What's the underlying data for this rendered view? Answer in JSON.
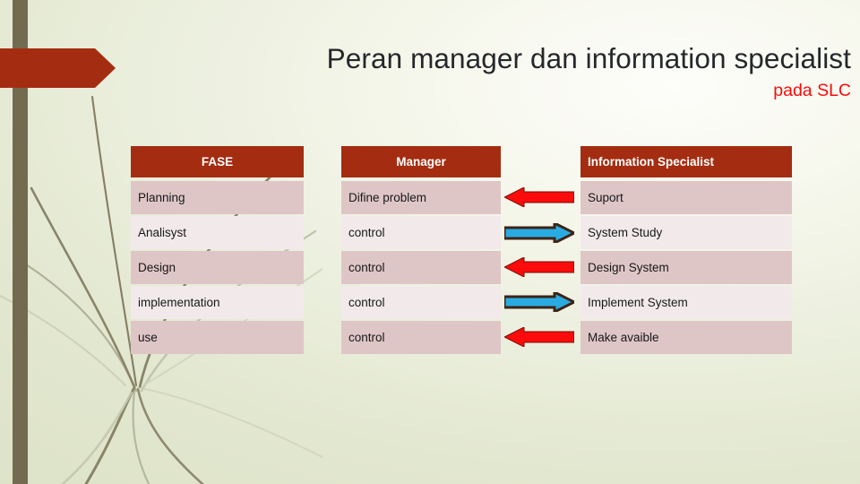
{
  "slide": {
    "title_main": "Peran manager dan information specialist",
    "title_sub": "pada SLC",
    "accent_red": "#a42d11",
    "title_sub_color": "#fb0b0b",
    "background_green": "#e2e7cf",
    "left_bar_color": "#736b4f",
    "row_band_dark": "#dfc6c6",
    "row_band_light": "#f2eaea",
    "arrow_red": "#fb0b0b",
    "arrow_blue": "#29abe2",
    "arrow_outline": "#3d2314"
  },
  "table": {
    "headers": [
      {
        "label": "FASE",
        "align": "center"
      },
      {
        "label": "Manager",
        "align": "center"
      },
      {
        "label": "Information Specialist",
        "align": "left"
      }
    ],
    "rows": [
      {
        "fase": "Planning",
        "manager": "Difine problem",
        "arrow": "left-red",
        "specialist": "Suport"
      },
      {
        "fase": "Analisyst",
        "manager": "control",
        "arrow": "right-blue",
        "specialist": "System Study"
      },
      {
        "fase": "Design",
        "manager": "control",
        "arrow": "left-red",
        "specialist": "Design System"
      },
      {
        "fase": "implementation",
        "manager": "control",
        "arrow": "right-blue",
        "specialist": "Implement System"
      },
      {
        "fase": "use",
        "manager": "control",
        "arrow": "left-red",
        "specialist": "Make avaible"
      }
    ]
  },
  "decor": {
    "banner_arrow": "banner-arrow-shape",
    "grass_lines": "decorative-grass-strokes"
  }
}
